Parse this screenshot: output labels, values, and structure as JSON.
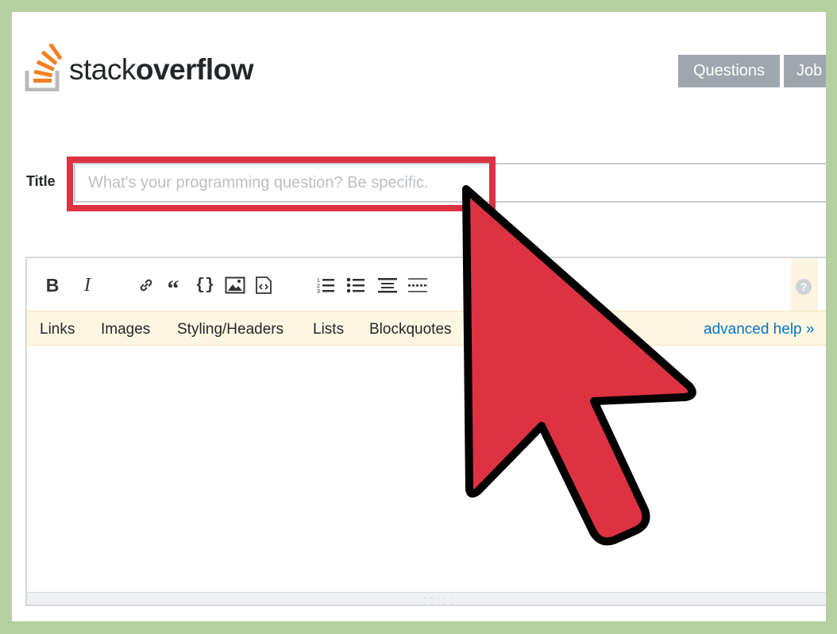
{
  "logo": {
    "text_light": "stack",
    "text_bold": "overflow",
    "icon": "stackoverflow-logo-icon",
    "brand_color": "#f48024"
  },
  "nav": {
    "questions": "Questions",
    "jobs": "Job"
  },
  "form": {
    "title_label": "Title",
    "title_placeholder": "What's your programming question? Be specific.",
    "title_value": ""
  },
  "toolbar": {
    "buttons": [
      {
        "name": "bold-icon",
        "glyph": "B"
      },
      {
        "name": "italic-icon",
        "glyph": "I"
      },
      {
        "name": "link-icon"
      },
      {
        "name": "blockquote-icon",
        "glyph": "66"
      },
      {
        "name": "code-icon",
        "glyph": "{}"
      },
      {
        "name": "image-icon"
      },
      {
        "name": "snippet-icon"
      },
      {
        "name": "numbered-list-icon"
      },
      {
        "name": "bulleted-list-icon"
      },
      {
        "name": "heading-icon"
      },
      {
        "name": "horizontal-rule-icon"
      }
    ],
    "help_icon": "?"
  },
  "help_bar": {
    "links": [
      "Links",
      "Images",
      "Styling/Headers",
      "Lists",
      "Blockquotes"
    ],
    "advanced": "advanced help »"
  },
  "colors": {
    "frame_border": "#b5cfa0",
    "highlight": "#dd3242",
    "cursor_fill": "#dd3242",
    "nav_button": "#9fa6ad",
    "link": "#0077cc",
    "help_bar_bg": "#fdf7e2"
  }
}
